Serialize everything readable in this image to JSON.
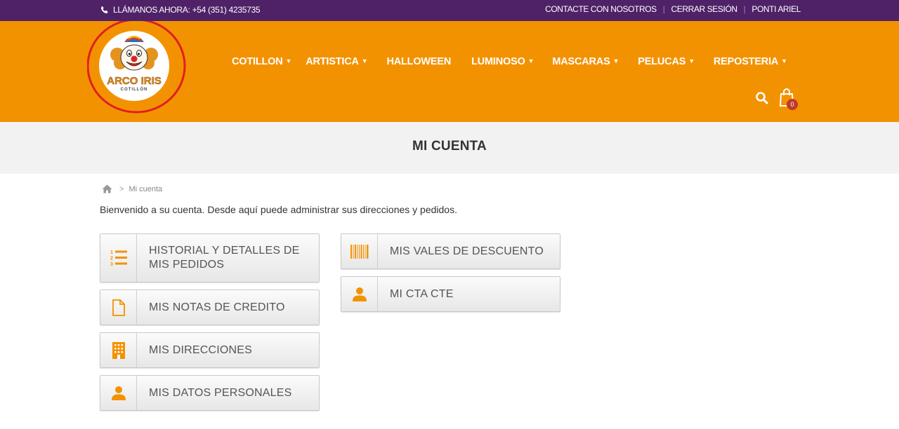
{
  "topbar": {
    "phone": "LLÁMANOS AHORA: +54 (351) 4235735",
    "links": [
      "CONTACTE CON NOSOTROS",
      "CERRAR SESIÓN",
      "PONTI ARIEL"
    ]
  },
  "logo": {
    "brand": "ARCO IRIS",
    "sub": "COTILLÓN"
  },
  "nav": [
    "COTILLON",
    "ARTISTICA",
    "HALLOWEEN",
    "LUMINOSO",
    "MASCARAS",
    "PELUCAS",
    "REPOSTERIA"
  ],
  "cart": {
    "count": "0"
  },
  "page": {
    "title": "MI CUENTA",
    "breadcrumb_current": "Mi cuenta",
    "welcome": "Bienvenido a su cuenta. Desde aquí puede administrar sus direcciones y pedidos."
  },
  "account_links": [
    {
      "label": "HISTORIAL Y DETALLES DE MIS PEDIDOS",
      "icon": "list-ol-icon"
    },
    {
      "label": "MIS NOTAS DE CREDITO",
      "icon": "file-icon"
    },
    {
      "label": "MIS DIRECCIONES",
      "icon": "building-icon"
    },
    {
      "label": "MIS DATOS PERSONALES",
      "icon": "user-icon"
    },
    {
      "label": "MIS VALES DE DESCUENTO",
      "icon": "barcode-icon"
    },
    {
      "label": "MI CTA CTE",
      "icon": "user-icon"
    }
  ],
  "colors": {
    "topbar": "#4f2268",
    "header": "#f39200",
    "accent": "#f39200",
    "title_band": "#f2f2f2"
  }
}
